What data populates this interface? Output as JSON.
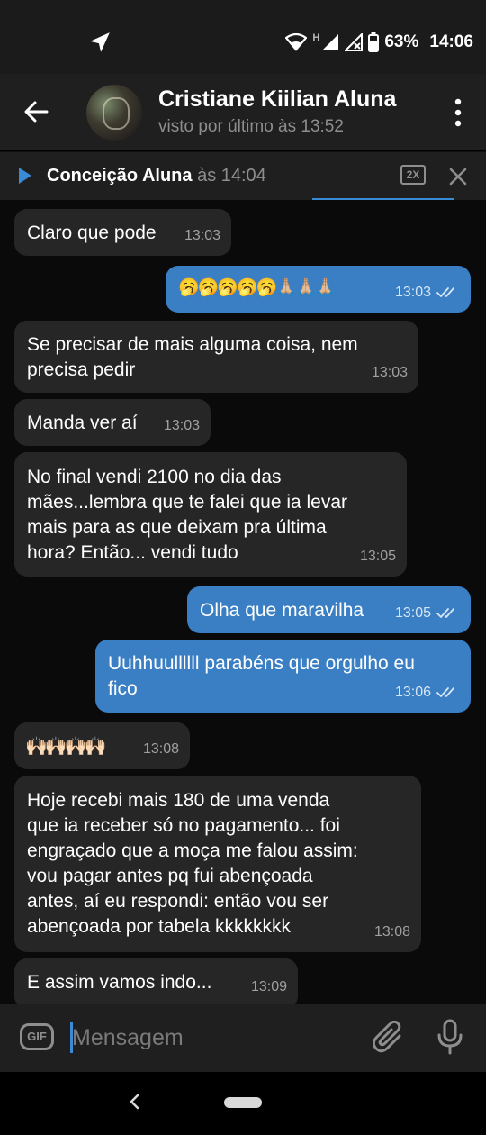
{
  "status_bar": {
    "signal_label": "H",
    "battery_pct": "63%",
    "clock": "14:06"
  },
  "header": {
    "contact_name": "Cristiane Kiilian Aluna",
    "last_seen": "visto por último às 13:52"
  },
  "player": {
    "author": "Conceição Aluna",
    "time": "às 14:04",
    "speed": "2X"
  },
  "messages": [
    {
      "dir": "in",
      "text": "Claro que pode",
      "time": "13:03"
    },
    {
      "dir": "out",
      "text": "🥱🥱🥱🥱🥱🙏🏼🙏🏼🙏🏼",
      "time": "13:03"
    },
    {
      "dir": "in",
      "text": "Se precisar de mais alguma coisa, nem\nprecisa pedir",
      "time": "13:03"
    },
    {
      "dir": "in",
      "text": "Manda ver aí",
      "time": "13:03"
    },
    {
      "dir": "in",
      "text": "No final vendi 2100 no dia das\nmães...lembra que te falei que ia levar\nmais para as que deixam pra última\nhora? Então... vendi tudo",
      "time": "13:05"
    },
    {
      "dir": "out",
      "text": "Olha que maravilha",
      "time": "13:05"
    },
    {
      "dir": "out",
      "text": "Uuhhuullllll parabéns que orgulho eu\nfico",
      "time": "13:06"
    },
    {
      "dir": "in",
      "text": "🙌🏻🙌🏻🙌🏻🙌🏻",
      "time": "13:08"
    },
    {
      "dir": "in",
      "text": "Hoje recebi mais 180 de uma venda\nque  ia receber só no pagamento... foi\nengraçado que a moça me falou assim:\nvou pagar antes pq fui abençoada\nantes, aí eu respondi: então vou ser\nabençoada por tabela kkkkkkkk",
      "time": "13:08"
    },
    {
      "dir": "in",
      "text": "E assim vamos indo...",
      "time": "13:09"
    }
  ],
  "input": {
    "gif_label": "GIF",
    "placeholder": "Mensagem"
  },
  "colors": {
    "incoming_bubble": "#262626",
    "outgoing_bubble": "#3a7ec3",
    "accent": "#3a8bd6",
    "background": "#0a0a0a"
  }
}
